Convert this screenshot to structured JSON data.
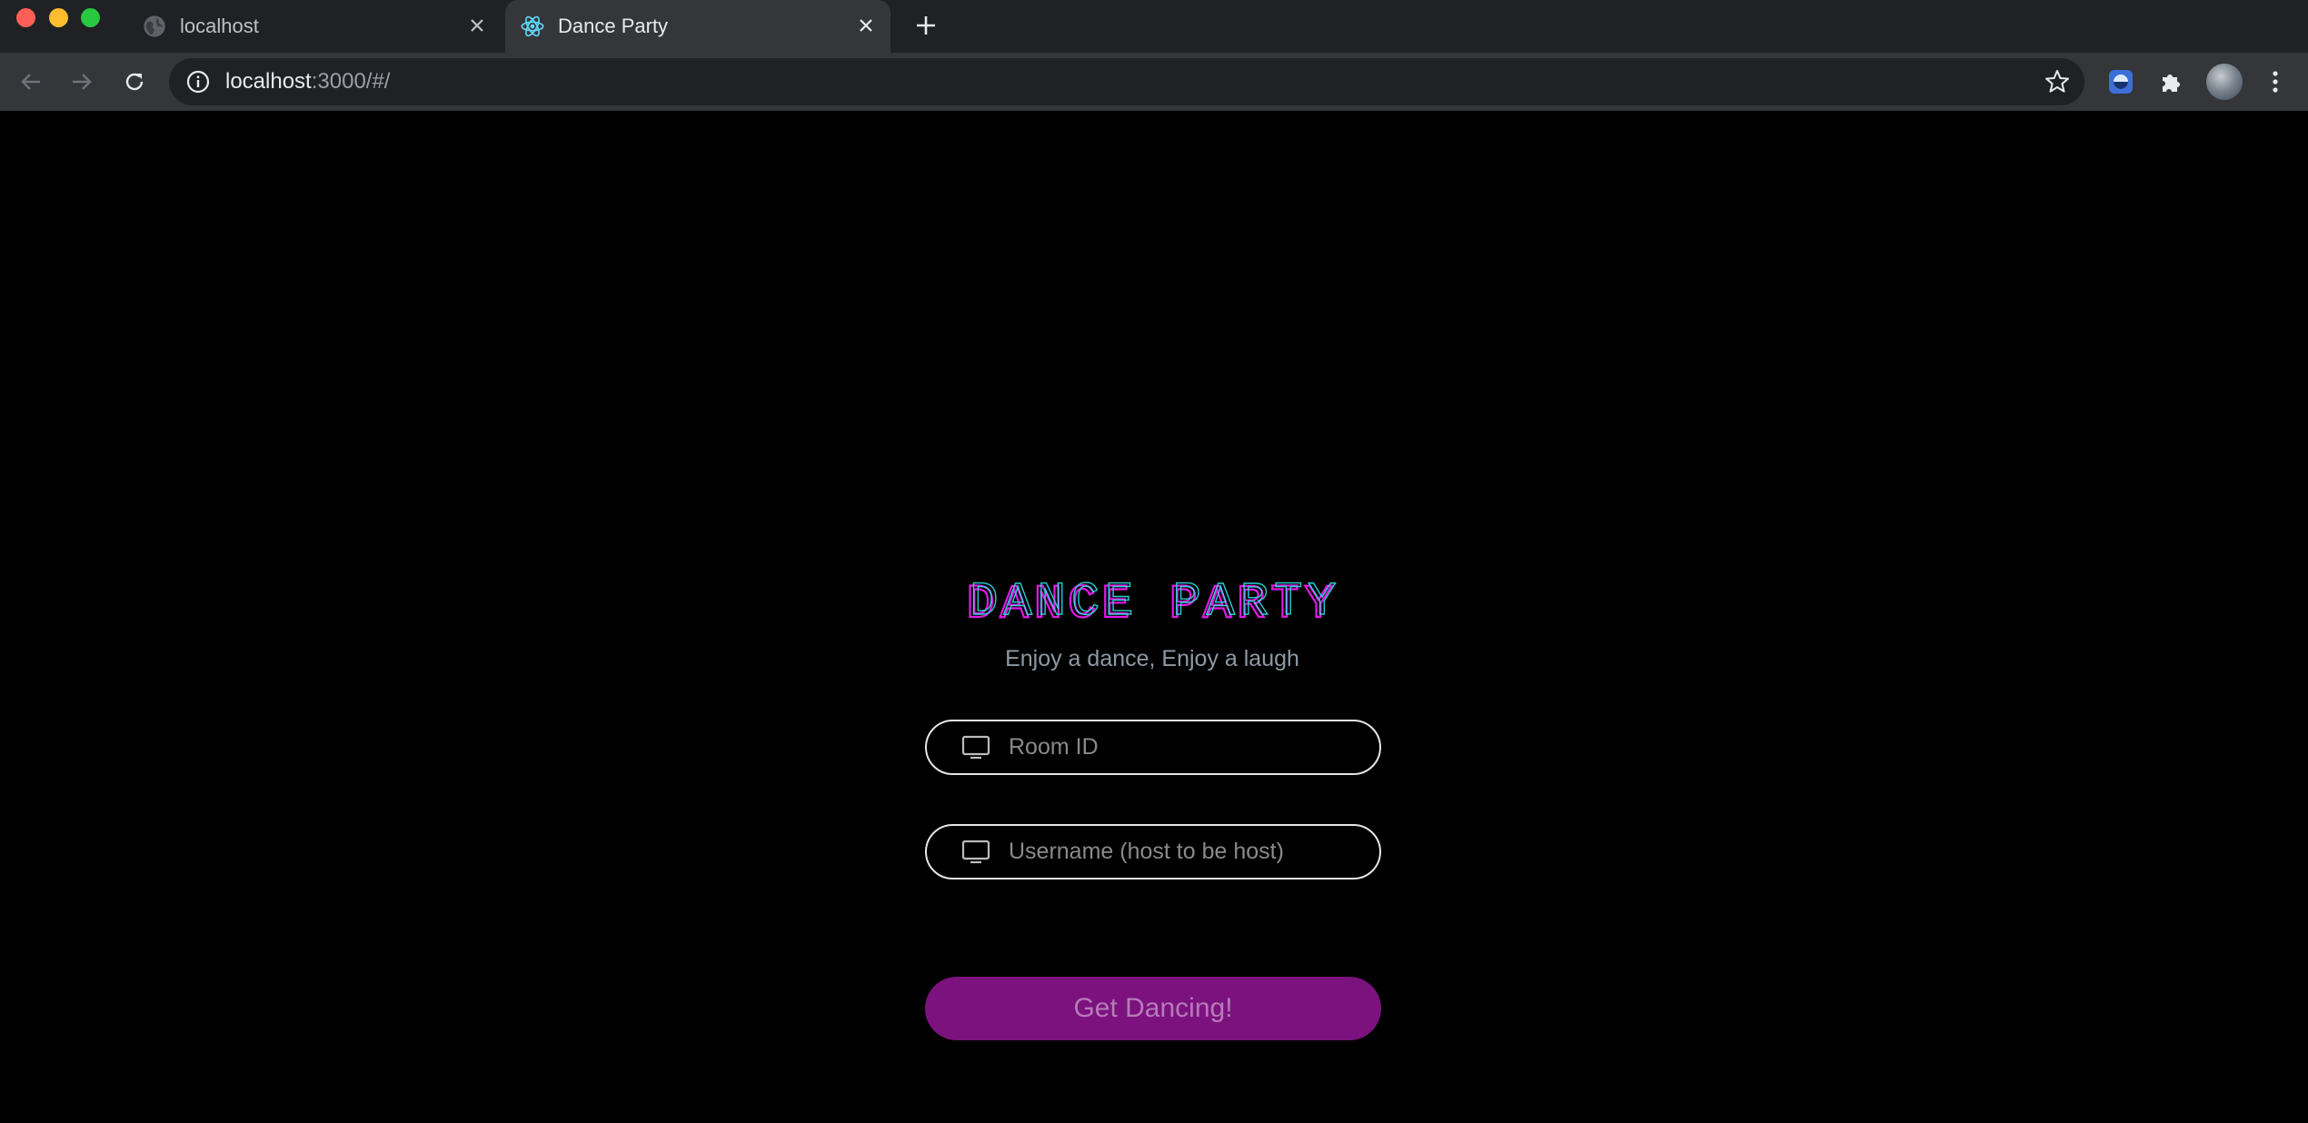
{
  "browser": {
    "tabs": [
      {
        "title": "localhost",
        "favicon": "globe-icon",
        "active": false
      },
      {
        "title": "Dance Party",
        "favicon": "react-icon",
        "active": true
      }
    ],
    "address": {
      "host": "localhost",
      "rest": ":3000/#/"
    }
  },
  "page": {
    "logo_text": "DANCE PARTY",
    "subtitle": "Enjoy a dance, Enjoy a laugh",
    "room_field": {
      "placeholder": "Room ID",
      "value": "",
      "icon": "monitor-icon"
    },
    "user_field": {
      "placeholder": "Username (host to be host)",
      "value": "",
      "icon": "monitor-icon"
    },
    "submit_label": "Get Dancing!"
  },
  "colors": {
    "logo_magenta": "#e11be6",
    "logo_cyan": "#2de1e8",
    "button_bg": "#7b127e",
    "button_text": "#b77ab9",
    "subtitle": "#8e99a4"
  }
}
